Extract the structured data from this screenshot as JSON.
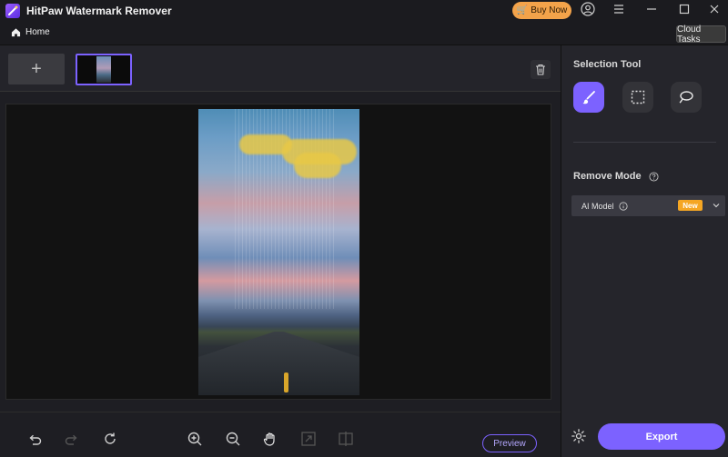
{
  "window": {
    "title": "HitPaw Watermark Remover",
    "buy_now_label": "Buy Now"
  },
  "nav": {
    "home_label": "Home",
    "cloud_tasks_label": "Cloud Tasks"
  },
  "thumbstrip": {
    "add_label": "+"
  },
  "toolbar": {
    "preview_label": "Preview"
  },
  "panel": {
    "selection_tool_title": "Selection Tool",
    "remove_mode_title": "Remove Mode",
    "mode_value": "AI Model",
    "new_badge": "New",
    "export_label": "Export"
  },
  "colors": {
    "accent": "#7c62ff",
    "buy_now": "#f3a34a",
    "new_badge": "#f5a623",
    "background": "#1b1b1f"
  }
}
